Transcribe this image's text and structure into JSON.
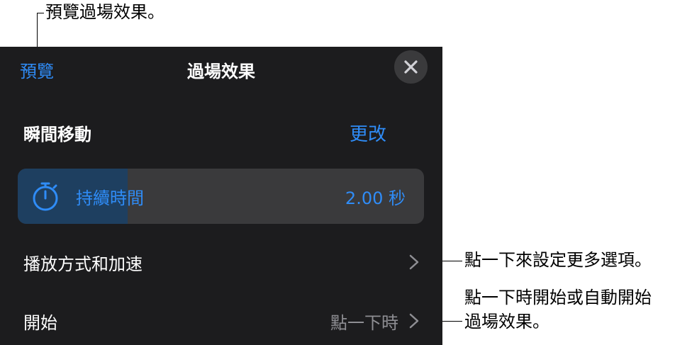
{
  "annotations": {
    "preview": "預覽過場效果。",
    "more_options": "點一下來設定更多選項。",
    "start_line1": "點一下時開始或自動開始",
    "start_line2": "過場效果。"
  },
  "panel": {
    "preview_label": "預覽",
    "title": "過場效果",
    "close_icon": "close-icon",
    "effect_name": "瞬間移動",
    "change_label": "更改",
    "duration": {
      "label": "持續時間",
      "value": "2.00 秒",
      "icon": "timer-icon",
      "fill_fraction": 0.27
    },
    "playback_row": {
      "label": "播放方式和加速",
      "icon": "chevron-right-icon"
    },
    "start_row": {
      "label": "開始",
      "value": "點一下時",
      "icon": "chevron-right-icon"
    }
  },
  "colors": {
    "accent": "#2f8cf7",
    "panel_bg": "#1c1c1e",
    "control_bg": "#3a3a3c",
    "secondary_text": "#8e8e93"
  }
}
